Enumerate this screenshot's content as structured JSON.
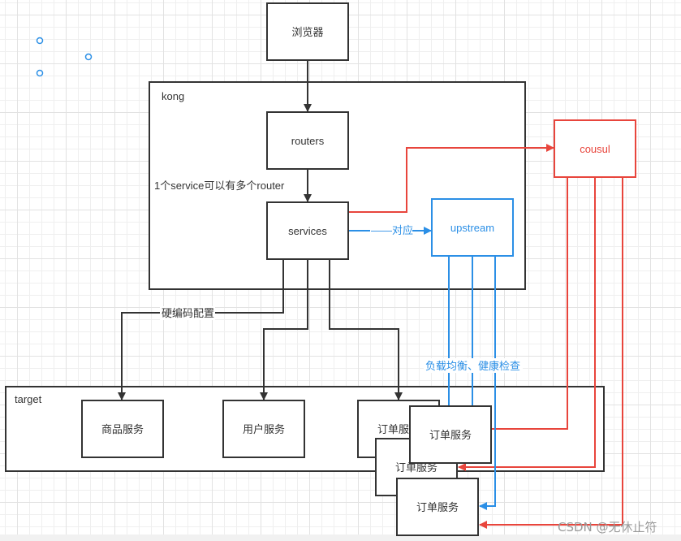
{
  "colors": {
    "black": "#333333",
    "red": "#e8453c",
    "blue": "#2b8fe6",
    "handle": "#2b8fe6"
  },
  "containers": {
    "kong": {
      "label": "kong"
    },
    "target": {
      "label": "target"
    }
  },
  "nodes": {
    "browser": {
      "label": "浏览器"
    },
    "routers": {
      "label": "routers"
    },
    "services": {
      "label": "services"
    },
    "upstream": {
      "label": "upstream"
    },
    "cousul": {
      "label": "cousul"
    },
    "product_service": {
      "label": "商品服务"
    },
    "user_service": {
      "label": "用户服务"
    },
    "order_service_1": {
      "label": "订单服务"
    },
    "order_service_2": {
      "label": "订单服务"
    },
    "order_service_3": {
      "label": "订单服务"
    },
    "order_service_4": {
      "label": "订单服务"
    }
  },
  "edge_labels": {
    "service_router": "1个service可以有多个router",
    "maps_to": "——对应",
    "hardcoded": "硬编码配置",
    "lb_health": "负载均衡、健康检查"
  },
  "watermark": "CSDN @无休止符"
}
